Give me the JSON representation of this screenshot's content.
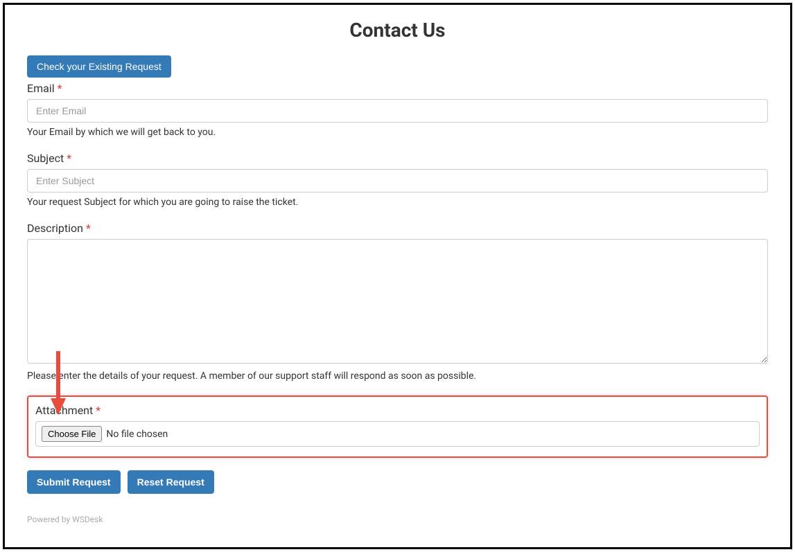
{
  "page": {
    "title": "Contact Us"
  },
  "checkButton": {
    "label": "Check your Existing Request"
  },
  "form": {
    "email": {
      "label": "Email",
      "required": "*",
      "placeholder": "Enter Email",
      "help": "Your Email by which we will get back to you."
    },
    "subject": {
      "label": "Subject",
      "required": "*",
      "placeholder": "Enter Subject",
      "help": "Your request Subject for which you are going to raise the ticket."
    },
    "description": {
      "label": "Description",
      "required": "*",
      "help": "Please enter the details of your request. A member of our support staff will respond as soon as possible."
    },
    "attachment": {
      "label": "Attachment",
      "required": "*",
      "chooseLabel": "Choose File",
      "status": "No file chosen"
    }
  },
  "actions": {
    "submit": "Submit Request",
    "reset": "Reset Request"
  },
  "footer": {
    "poweredBy": "Powered by ",
    "brand": "WSDesk"
  }
}
